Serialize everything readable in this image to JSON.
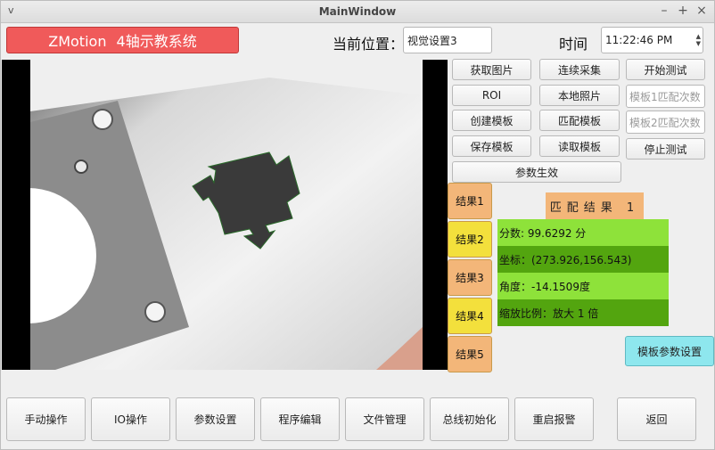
{
  "window": {
    "title": "MainWindow",
    "menu_icon": "v",
    "min": "–",
    "max": "+",
    "close": "×"
  },
  "header": {
    "app_title": "ZMotion    4轴示教系统",
    "position_label": "当前位置：",
    "position_value": "视觉设置3",
    "time_label": "时间",
    "time_value": "11:22:46 PM"
  },
  "controls": {
    "get_image": "获取图片",
    "continuous": "连续采集",
    "start_test": "开始测试",
    "roi": "ROI",
    "local_photo": "本地照片",
    "tpl1_placeholder": "模板1匹配次数",
    "create_template": "创建模板",
    "match_template": "匹配模板",
    "tpl2_placeholder": "模板2匹配次数",
    "save_template": "保存模板",
    "read_template": "读取模板",
    "stop_test": "停止测试",
    "apply_params": "参数生效",
    "template_params": "模板参数设置"
  },
  "results": {
    "tabs": [
      "结果1",
      "结果2",
      "结果3",
      "结果4",
      "结果5"
    ],
    "header": "匹配结果 1",
    "score": "分数: 99.6292 分",
    "coord": "坐标：(273.926,156.543)",
    "angle": "角度：-14.1509度",
    "scale": "缩放比例：放大 1 倍"
  },
  "bottom_nav": {
    "manual": "手动操作",
    "io": "IO操作",
    "params": "参数设置",
    "program": "程序编辑",
    "files": "文件管理",
    "bus_init": "总线初始化",
    "restart_alarm": "重启报警",
    "back": "返回"
  },
  "colors": {
    "title_red": "#f05a5a",
    "green_light": "#8ee23a",
    "green_dark": "#53a50f",
    "orange": "#f3b679",
    "yellow": "#f3e03c",
    "cyan": "#8ee7ee"
  }
}
